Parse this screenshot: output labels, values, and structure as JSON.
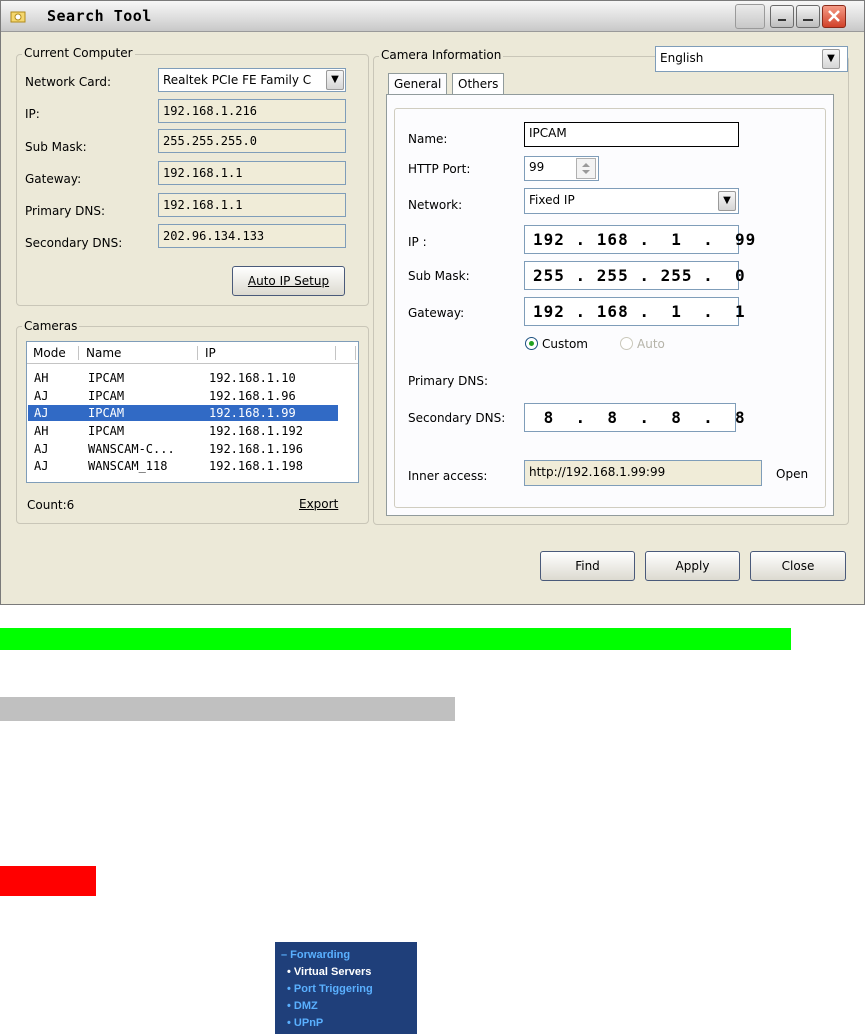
{
  "window": {
    "title": "Search Tool",
    "language": "English"
  },
  "current_computer": {
    "legend": "Current Computer",
    "network_card_label": "Network Card:",
    "network_card_value": "Realtek PCIe FE Family C",
    "ip_label": "IP:",
    "ip_value": "192.168.1.216",
    "submask_label": "Sub Mask:",
    "submask_value": "255.255.255.0",
    "gateway_label": "Gateway:",
    "gateway_value": "192.168.1.1",
    "primary_dns_label": "Primary DNS:",
    "primary_dns_value": "192.168.1.1",
    "secondary_dns_label": "Secondary DNS:",
    "secondary_dns_value": "202.96.134.133",
    "auto_ip_button": "Auto IP Setup"
  },
  "cameras": {
    "legend": "Cameras",
    "columns": [
      "Mode",
      "Name",
      "IP"
    ],
    "rows": [
      {
        "mode": "AH",
        "name": "IPCAM",
        "ip": "192.168.1.10"
      },
      {
        "mode": "AJ",
        "name": "IPCAM",
        "ip": "192.168.1.96"
      },
      {
        "mode": "AJ",
        "name": "IPCAM",
        "ip": "192.168.1.99"
      },
      {
        "mode": "AH",
        "name": "IPCAM",
        "ip": "192.168.1.192"
      },
      {
        "mode": "AJ",
        "name": "WANSCAM-C...",
        "ip": "192.168.1.196"
      },
      {
        "mode": "AJ",
        "name": "WANSCAM_118",
        "ip": "192.168.1.198"
      }
    ],
    "selected_index": 2,
    "count": "Count:6",
    "export": "Export"
  },
  "camera_info": {
    "legend": "Camera Information",
    "tabs": [
      "General",
      "Others"
    ],
    "name_label": "Name:",
    "name_value": "IPCAM",
    "http_port_label": "HTTP Port:",
    "http_port_value": "99",
    "network_label": "Network:",
    "network_value": "Fixed IP",
    "ip_label": "IP :",
    "ip_value": "192 . 168 .  1  .  99",
    "submask_label": "Sub Mask:",
    "submask_value": "255 . 255 . 255 .  0",
    "gateway_label": "Gateway:",
    "gateway_value": "192 . 168 .  1  .  1",
    "dns_mode_custom": "Custom",
    "dns_mode_auto": "Auto",
    "primary_dns_label": "Primary DNS:",
    "secondary_dns_label": "Secondary DNS:",
    "secondary_dns_value": " 8  .  8  .  8  .  8",
    "inner_access_label": "Inner access:",
    "inner_access_value": "http://192.168.1.99:99",
    "open_label": "Open"
  },
  "footer_buttons": {
    "find": "Find",
    "apply": "Apply",
    "close": "Close"
  },
  "forwarding_menu": {
    "header": "– Forwarding",
    "items": [
      "• Virtual Servers",
      "• Port Triggering",
      "• DMZ",
      "• UPnP"
    ]
  },
  "colors": {
    "window_bg": "#ece9d8",
    "selection": "#316ac5",
    "green_bar": "#00ff00",
    "gray_bar": "#c0c0c0",
    "red_bar": "#ff0000",
    "forwarding_bg": "#1f3f7a",
    "forwarding_header": "#5ab0ff"
  }
}
